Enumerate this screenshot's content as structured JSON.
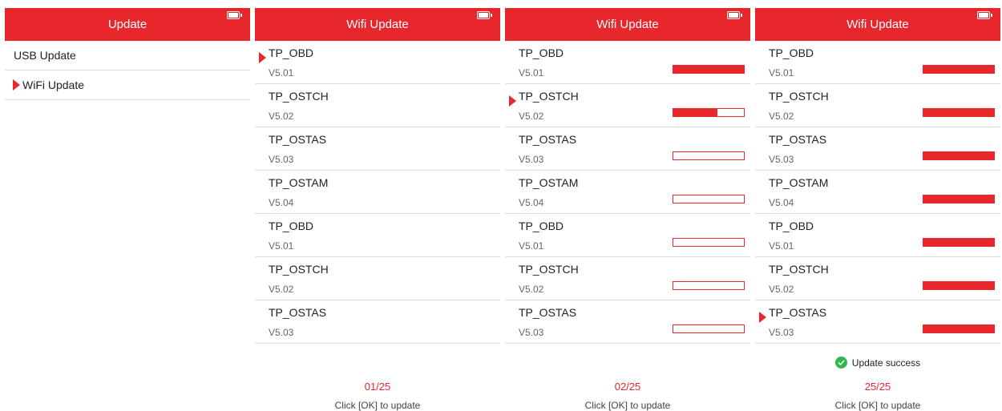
{
  "colors": {
    "accent": "#e8272c",
    "success": "#2db84d"
  },
  "screen1": {
    "title": "Update",
    "menu": [
      {
        "label": "USB Update",
        "selected": false
      },
      {
        "label": "WiFi Update",
        "selected": true
      }
    ]
  },
  "screen2": {
    "title": "Wifi Update",
    "items": [
      {
        "name": "TP_OBD",
        "version": "V5.01"
      },
      {
        "name": "TP_OSTCH",
        "version": "V5.02"
      },
      {
        "name": "TP_OSTAS",
        "version": "V5.03"
      },
      {
        "name": "TP_OSTAM",
        "version": "V5.04"
      },
      {
        "name": "TP_OBD",
        "version": "V5.01"
      },
      {
        "name": "TP_OSTCH",
        "version": "V5.02"
      },
      {
        "name": "TP_OSTAS",
        "version": "V5.03"
      }
    ],
    "selected_index": 0,
    "page": "01/25",
    "hint": "Click [OK] to update"
  },
  "screen3": {
    "title": "Wifi Update",
    "items": [
      {
        "name": "TP_OBD",
        "version": "V5.01",
        "progress": 1.0
      },
      {
        "name": "TP_OSTCH",
        "version": "V5.02",
        "progress": 0.62
      },
      {
        "name": "TP_OSTAS",
        "version": "V5.03",
        "progress": 0
      },
      {
        "name": "TP_OSTAM",
        "version": "V5.04",
        "progress": 0
      },
      {
        "name": "TP_OBD",
        "version": "V5.01",
        "progress": 0
      },
      {
        "name": "TP_OSTCH",
        "version": "V5.02",
        "progress": 0
      },
      {
        "name": "TP_OSTAS",
        "version": "V5.03",
        "progress": 0
      }
    ],
    "selected_index": 1,
    "page": "02/25",
    "hint": "Click [OK] to update"
  },
  "screen4": {
    "title": "Wifi Update",
    "items": [
      {
        "name": "TP_OBD",
        "version": "V5.01",
        "progress": 1.0
      },
      {
        "name": "TP_OSTCH",
        "version": "V5.02",
        "progress": 1.0
      },
      {
        "name": "TP_OSTAS",
        "version": "V5.03",
        "progress": 1.0
      },
      {
        "name": "TP_OSTAM",
        "version": "V5.04",
        "progress": 1.0
      },
      {
        "name": "TP_OBD",
        "version": "V5.01",
        "progress": 1.0
      },
      {
        "name": "TP_OSTCH",
        "version": "V5.02",
        "progress": 1.0
      },
      {
        "name": "TP_OSTAS",
        "version": "V5.03",
        "progress": 1.0
      }
    ],
    "selected_index": 6,
    "status": "Update success",
    "page": "25/25",
    "hint": "Click [OK] to update"
  }
}
